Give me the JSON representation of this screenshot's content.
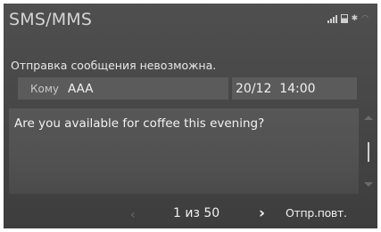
{
  "header": {
    "title": "SMS/MMS",
    "status_icons": [
      "signal-icon",
      "battery-icon",
      "bluetooth-icon",
      "wifi-icon"
    ]
  },
  "status_message": "Отправка сообщения невозможна.",
  "recipient": {
    "label": "Кому",
    "value": "AAA"
  },
  "timestamp": "20/12  14:00",
  "message": {
    "body": "Are you available for coffee this evening?"
  },
  "pagination": {
    "indicator": "1 из 50",
    "prev_icon": "‹",
    "next_icon": "›"
  },
  "actions": {
    "resend_label": "Отпр.повт."
  },
  "colors": {
    "background": "#474747",
    "field_background": "#5b5b5b",
    "text": "#f0f0f0",
    "dim_text": "#c8c8c8"
  }
}
